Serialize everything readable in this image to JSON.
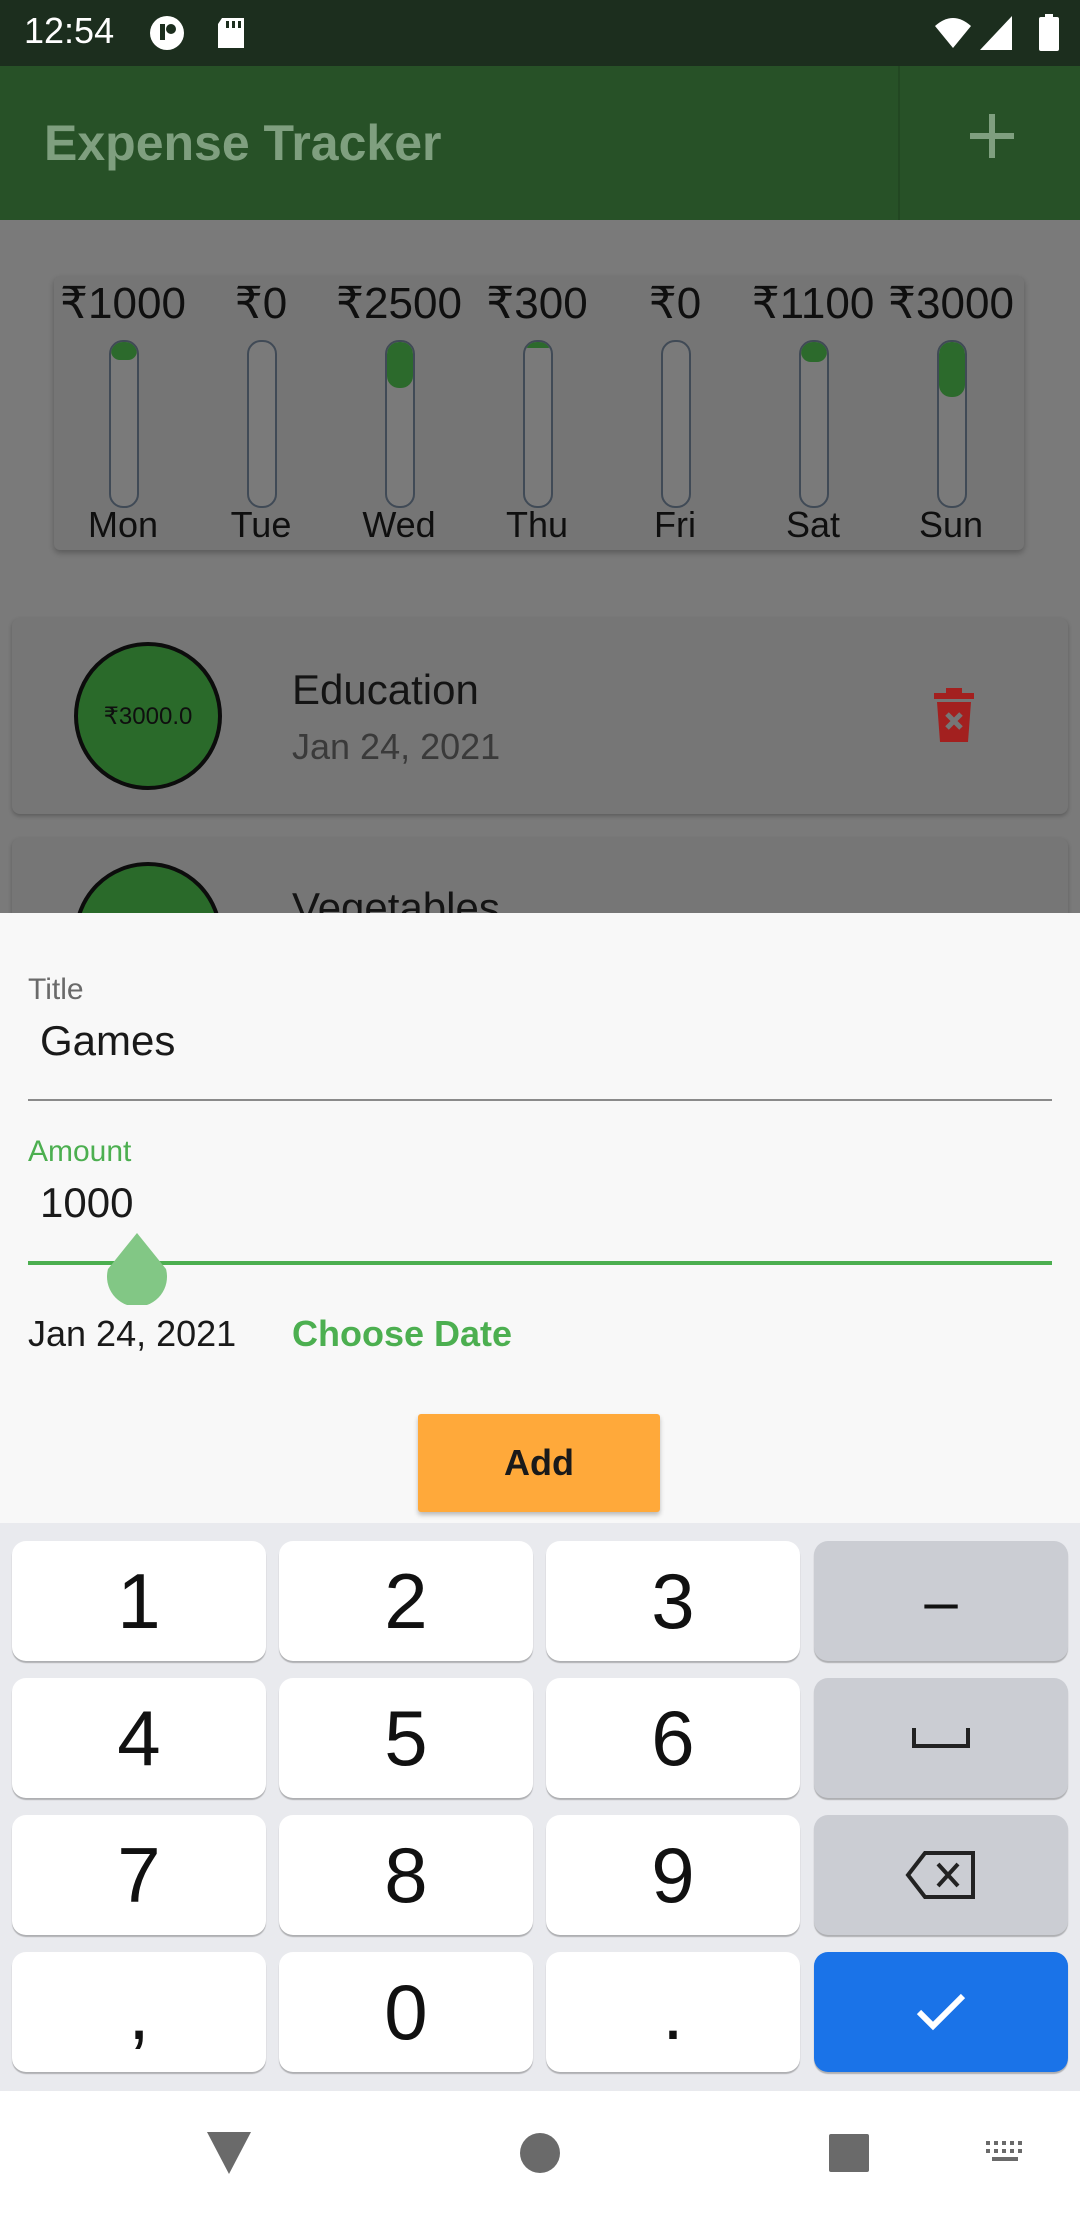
{
  "status_bar": {
    "time": "12:54"
  },
  "app_bar": {
    "title": "Expense Tracker"
  },
  "chart_data": {
    "type": "bar",
    "categories": [
      "Mon",
      "Tue",
      "Wed",
      "Thu",
      "Fri",
      "Sat",
      "Sun"
    ],
    "values": [
      1000,
      0,
      2500,
      300,
      0,
      1100,
      3000
    ],
    "value_labels": [
      "₹1000",
      "₹0",
      "₹2500",
      "₹300",
      "₹0",
      "₹1100",
      "₹3000"
    ],
    "max": 8900,
    "fill_color": "#2c6a2c"
  },
  "transactions": [
    {
      "amount": "₹3000.0",
      "title": "Education",
      "date": "Jan 24, 2021"
    },
    {
      "amount": "",
      "title": "Vegetables",
      "date": ""
    }
  ],
  "form": {
    "title_label": "Title",
    "title_value": "Games",
    "amount_label": "Amount",
    "amount_value": "1000",
    "date_value": "Jan 24, 2021",
    "choose_date_label": "Choose Date",
    "add_label": "Add"
  },
  "keyboard": {
    "rows": [
      [
        "1",
        "2",
        "3",
        "–"
      ],
      [
        "4",
        "5",
        "6",
        "␣"
      ],
      [
        "7",
        "8",
        "9",
        "⌫"
      ],
      [
        ",",
        "0",
        ".",
        "✓"
      ]
    ]
  },
  "colors": {
    "app_bar": "#275127",
    "accent_green": "#4caf50",
    "add_button": "#ffa93a",
    "enter_key": "#1a73e8",
    "delete_icon": "#a3201f"
  }
}
